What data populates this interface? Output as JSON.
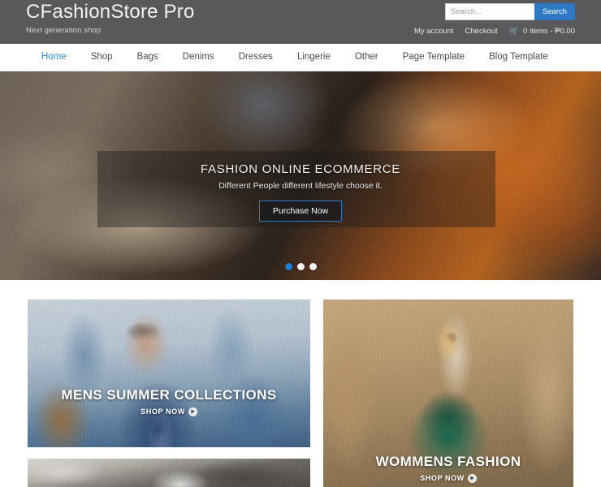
{
  "header": {
    "brand_title": "CFashionStore Pro",
    "tagline": "Next generation shop",
    "search": {
      "placeholder": "Search...",
      "value": "",
      "button_label": "Search"
    },
    "utility": {
      "my_account": "My account",
      "checkout": "Checkout",
      "cart_icon": "shopping-cart-icon",
      "cart_text": "0 items - ₱0.00"
    },
    "bg_color": "#59595b",
    "accent_color": "#2f78c4"
  },
  "nav": {
    "items": [
      {
        "label": "Home",
        "active": true
      },
      {
        "label": "Shop",
        "active": false
      },
      {
        "label": "Bags",
        "active": false
      },
      {
        "label": "Denims",
        "active": false
      },
      {
        "label": "Dresses",
        "active": false
      },
      {
        "label": "Lingerie",
        "active": false
      },
      {
        "label": "Other",
        "active": false
      },
      {
        "label": "Page Template",
        "active": false
      },
      {
        "label": "Blog Template",
        "active": false
      }
    ],
    "active_color": "#3b84d8"
  },
  "hero": {
    "title": "FASHION ONLINE ECOMMERCE",
    "subtitle": "Different People different lifestyle choose it.",
    "cta_label": "Purchase Now",
    "image_alt": "brown leather brogue shoes beside folded wool fabric",
    "dots": [
      {
        "index": 1,
        "active": true
      },
      {
        "index": 2,
        "active": false
      },
      {
        "index": 3,
        "active": false
      }
    ],
    "active_dot_color": "#1f7fd4"
  },
  "promos": {
    "mens": {
      "title": "MENS SUMMER COLLECTIONS",
      "shop_label": "SHOP NOW",
      "image_alt": "man in blue suit with sunglasses sitting on sofa"
    },
    "car": {
      "title": "",
      "shop_label": "",
      "image_alt": "classic car detail"
    },
    "womens": {
      "title": "WOMMENS FASHION",
      "shop_label": "SHOP NOW",
      "image_alt": "woman in green floral dress in sunlit alley"
    }
  }
}
